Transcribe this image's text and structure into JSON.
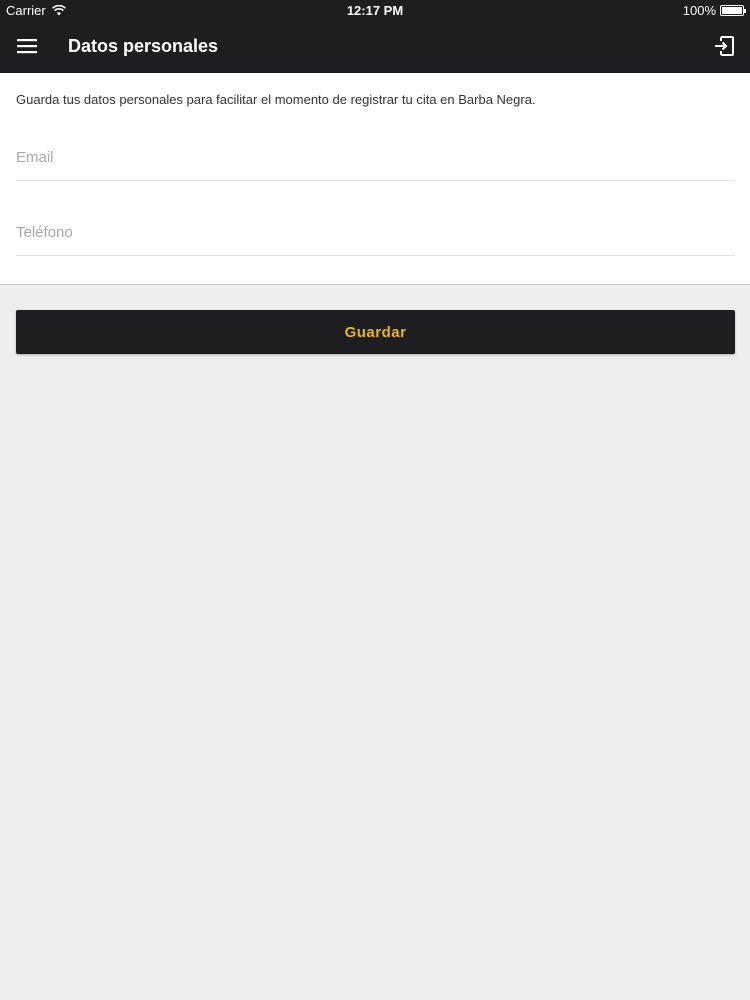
{
  "status_bar": {
    "carrier": "Carrier",
    "time": "12:17 PM",
    "battery": "100%",
    "battery_level": 1.0
  },
  "toolbar": {
    "title": "Datos personales",
    "menu_icon": "hamburger-menu-icon",
    "logout_icon": "logout-icon"
  },
  "form": {
    "intro": "Guarda tus datos personales para facilitar el momento de registrar tu cita en Barba Negra.",
    "email": {
      "value": "",
      "placeholder": "Email"
    },
    "phone": {
      "value": "",
      "placeholder": "Teléfono"
    },
    "save_label": "Guardar"
  },
  "colors": {
    "toolbar_bg": "#1e1d1f",
    "accent": "#e6b622",
    "page_bg": "#efeeef"
  }
}
